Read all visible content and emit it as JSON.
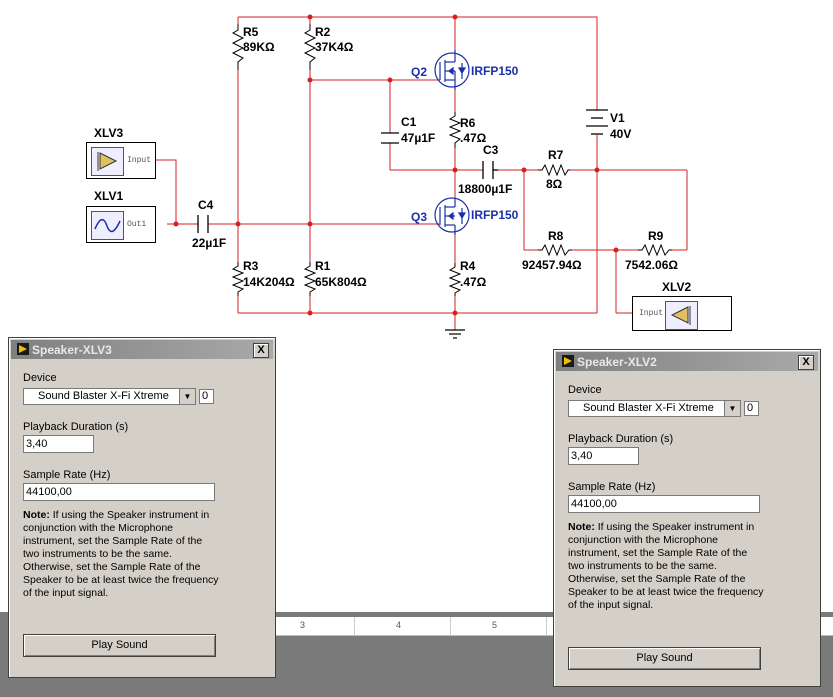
{
  "schematic": {
    "components": {
      "r5": {
        "name": "R5",
        "value": "89KΩ"
      },
      "r2": {
        "name": "R2",
        "value": "37K4Ω"
      },
      "q2": {
        "name": "Q2",
        "model": "IRFP150"
      },
      "c1": {
        "name": "C1",
        "value": "47µ1F"
      },
      "r6": {
        "name": "R6",
        "value": ".47Ω"
      },
      "v1": {
        "name": "V1",
        "value": "40V"
      },
      "c3": {
        "name": "C3",
        "value": "18800µ1F"
      },
      "r7": {
        "name": "R7",
        "value": "8Ω"
      },
      "c4": {
        "name": "C4",
        "value": "22µ1F"
      },
      "q3": {
        "name": "Q3",
        "model": "IRFP150"
      },
      "r8": {
        "name": "R8",
        "value": "92457.94Ω"
      },
      "r9": {
        "name": "R9",
        "value": "7542.06Ω"
      },
      "r3": {
        "name": "R3",
        "value": "14K204Ω"
      },
      "r1": {
        "name": "R1",
        "value": "65K804Ω"
      },
      "r4": {
        "name": "R4",
        "value": ".47Ω"
      }
    },
    "instruments": {
      "xlv3": {
        "name": "XLV3",
        "port": "Input"
      },
      "xlv1": {
        "name": "XLV1",
        "port": "Out1"
      },
      "xlv2": {
        "name": "XLV2",
        "port": "Input"
      }
    },
    "wire_color": "#d42020"
  },
  "ruler": {
    "ticks": [
      "3",
      "4",
      "5"
    ]
  },
  "dialog_xlv3": {
    "title": "Speaker-XLV3",
    "close": "X",
    "device_label": "Device",
    "device_value": "Sound Blaster X-Fi Xtreme",
    "device_index": "0",
    "duration_label": "Playback Duration (s)",
    "duration_value": "3,40",
    "rate_label": "Sample Rate (Hz)",
    "rate_value": "44100,00",
    "note_label": "Note:",
    "note_text": " If using the Speaker instrument in conjunction with the Microphone instrument, set the Sample Rate of the two instruments to be the same. Otherwise, set the Sample Rate of the Speaker to be at least twice the frequency of the input signal.",
    "play_label": "Play Sound"
  },
  "dialog_xlv2": {
    "title": "Speaker-XLV2",
    "close": "X",
    "device_label": "Device",
    "device_value": "Sound Blaster X-Fi Xtreme",
    "device_index": "0",
    "duration_label": "Playback Duration (s)",
    "duration_value": "3,40",
    "rate_label": "Sample Rate (Hz)",
    "rate_value": "44100,00",
    "note_label": "Note:",
    "note_text": " If using the Speaker instrument in conjunction with the Microphone instrument, set the Sample Rate of the two instruments to be the same. Otherwise, set the Sample Rate of the Speaker to be at least twice the frequency of the input signal.",
    "play_label": "Play Sound"
  }
}
